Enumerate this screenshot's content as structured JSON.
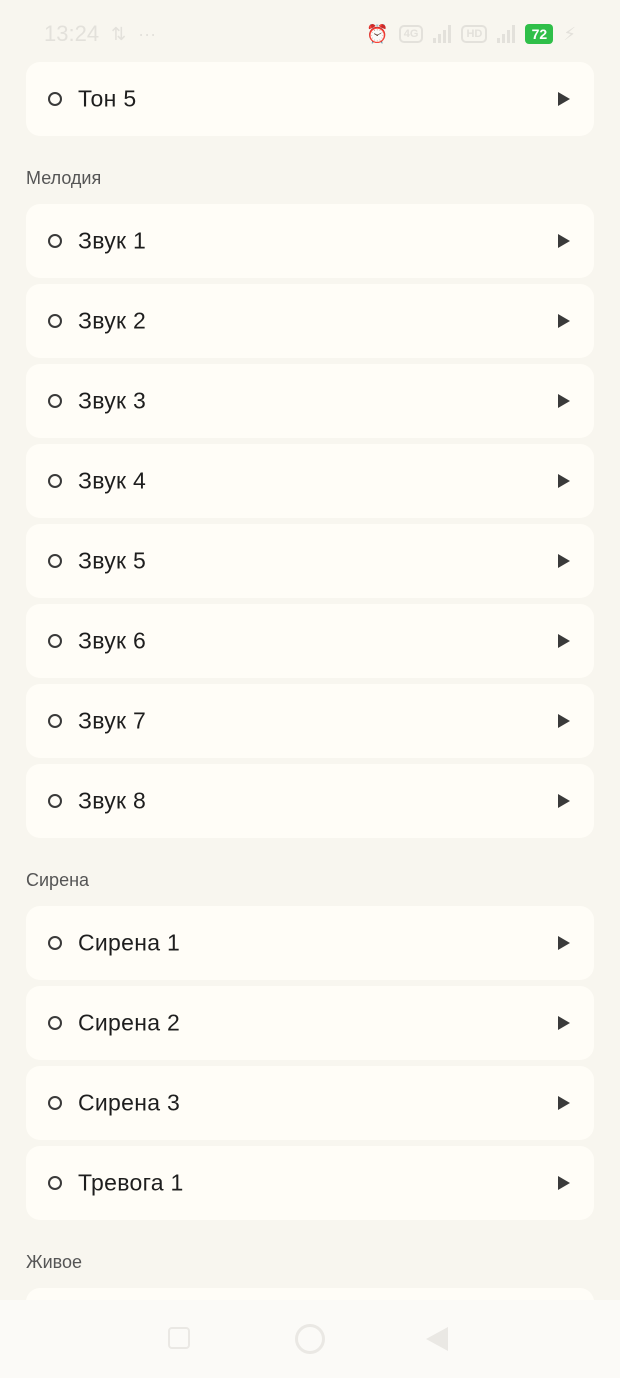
{
  "status": {
    "time": "13:24",
    "dots": "···",
    "net1": "4G",
    "battery": "72"
  },
  "sections": {
    "melody": "Мелодия",
    "siren": "Сирена",
    "live": "Живое"
  },
  "items": {
    "top": "Тон 5",
    "melody": [
      "Звук 1",
      "Звук 2",
      "Звук 3",
      "Звук 4",
      "Звук 5",
      "Звук 6",
      "Звук 7",
      "Звук 8"
    ],
    "siren": [
      "Сирена 1",
      "Сирена 2",
      "Сирена 3",
      "Тревога 1"
    ]
  },
  "colors": {
    "background": "#f8f6ef",
    "card": "#fffdf7",
    "battery": "#2fbf49"
  }
}
